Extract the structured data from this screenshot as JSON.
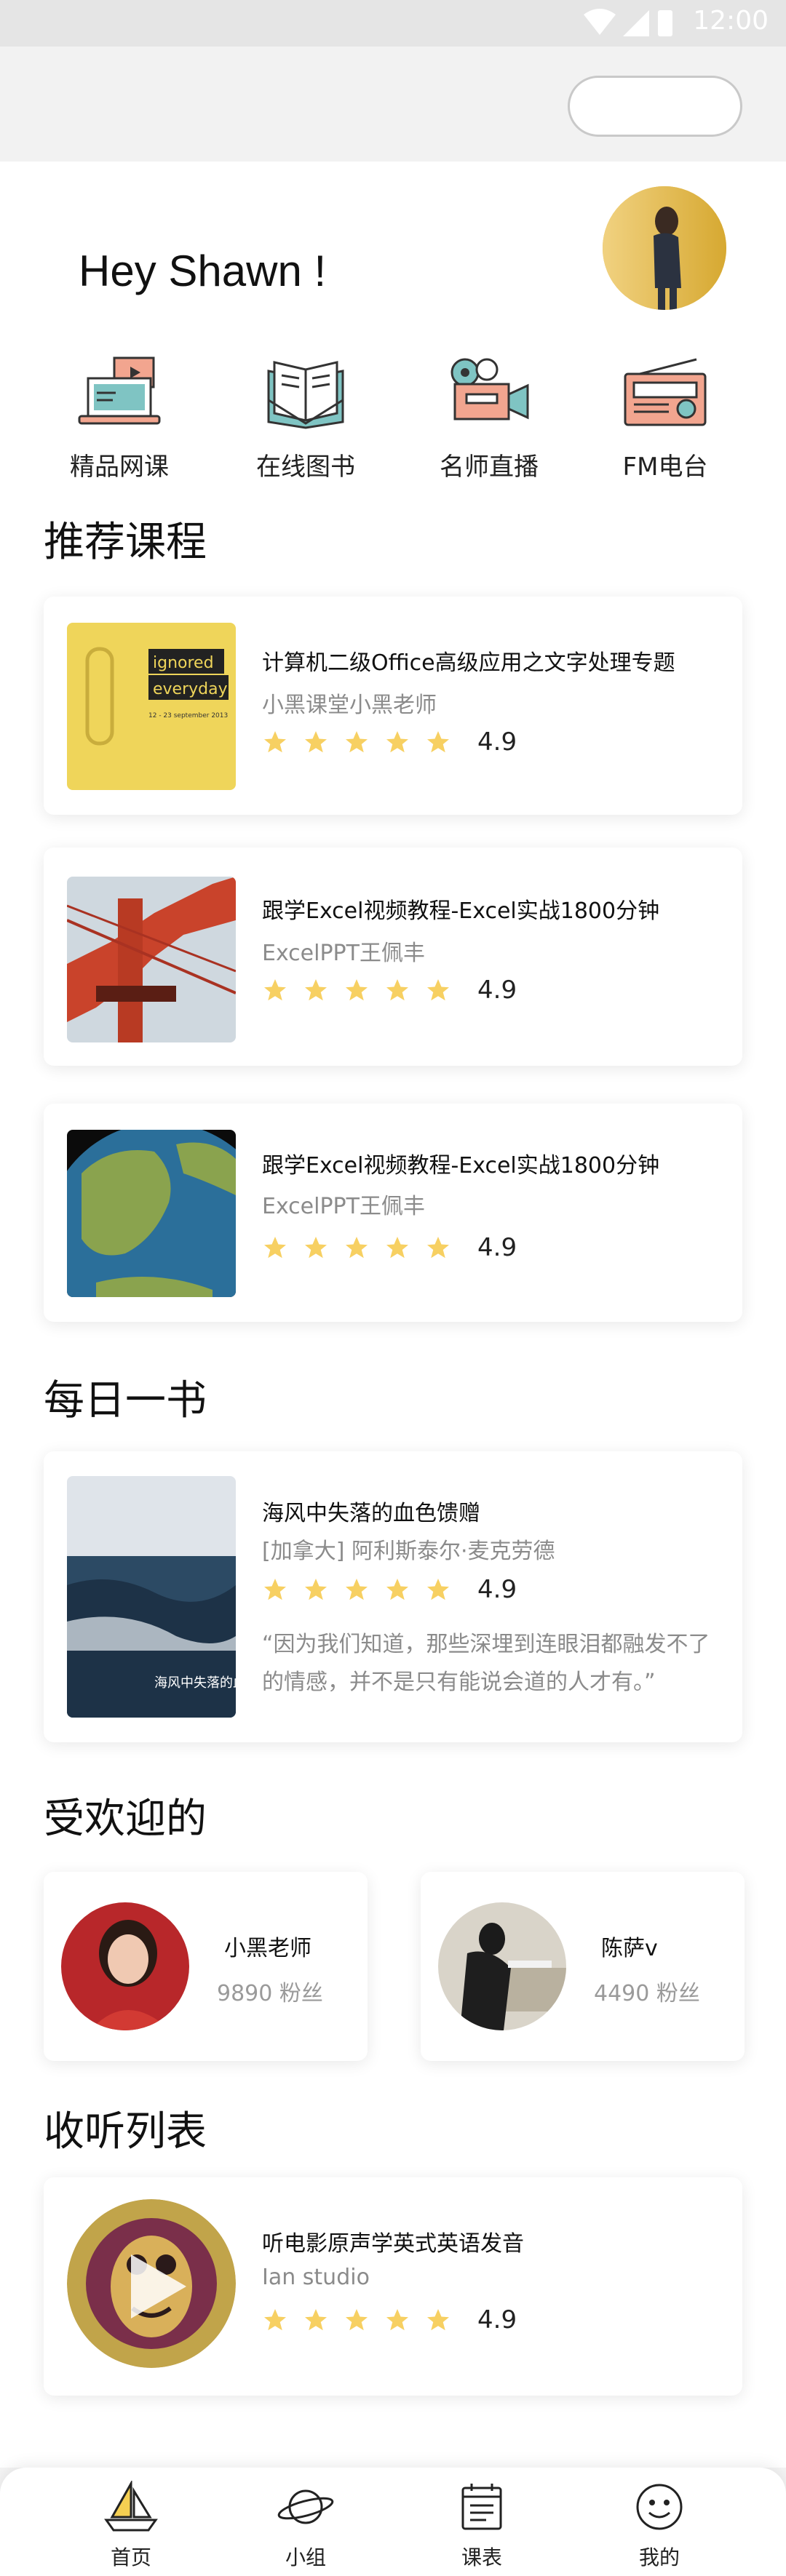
{
  "status": {
    "time": "12:00"
  },
  "header": {
    "greeting": "Hey Shawn !"
  },
  "shortcuts": [
    {
      "label": "精品网课",
      "icon": "laptop-play-icon"
    },
    {
      "label": "在线图书",
      "icon": "open-book-icon"
    },
    {
      "label": "名师直播",
      "icon": "camera-icon"
    },
    {
      "label": "FM电台",
      "icon": "radio-icon"
    }
  ],
  "sections": {
    "recommended": "推荐课程",
    "daily_book": "每日一书",
    "popular": "受欢迎的",
    "listening": "收听列表"
  },
  "courses": [
    {
      "title": "计算机二级Office高级应用之文字处理专题",
      "author": "小黑课堂小黑老师",
      "rating": "4.9"
    },
    {
      "title": "跟学Excel视频教程-Excel实战1800分钟",
      "author": "ExcelPPT王佩丰",
      "rating": "4.9"
    },
    {
      "title": "跟学Excel视频教程-Excel实战1800分钟",
      "author": "ExcelPPT王佩丰",
      "rating": "4.9"
    }
  ],
  "thumb1": {
    "line1": "ignored",
    "line2": "everyday",
    "date": "12 - 23 september 2013"
  },
  "book": {
    "title": "海风中失落的血色馈赠",
    "author": "[加拿大] 阿利斯泰尔·麦克劳德",
    "rating": "4.9",
    "quote": "“因为我们知道，那些深埋到连眼泪都融发不了的情感，并不是只有能说会道的人才有。”",
    "cover_text": "海风中失落的血色馈赠"
  },
  "popular": [
    {
      "name": "小黑老师",
      "fans": "9890 粉丝"
    },
    {
      "name": "陈萨v",
      "fans": "4490 粉丝"
    }
  ],
  "listening": [
    {
      "title": "听电影原声学英式英语发音",
      "author": "Ian studio",
      "rating": "4.9"
    }
  ],
  "tabs": [
    {
      "label": "首页",
      "icon": "sailboat-icon"
    },
    {
      "label": "小组",
      "icon": "planet-icon"
    },
    {
      "label": "课表",
      "icon": "calendar-icon"
    },
    {
      "label": "我的",
      "icon": "smiley-icon"
    }
  ],
  "colors": {
    "accent": "#f5cf52",
    "star": "#f7d062",
    "line": "#e05a3a"
  }
}
